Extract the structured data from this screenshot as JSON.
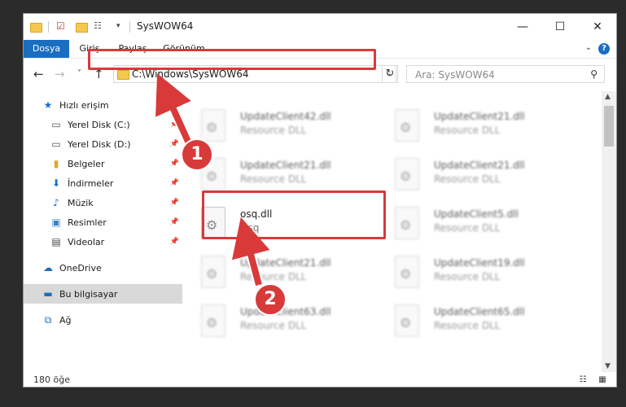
{
  "window": {
    "title": "SysWOW64"
  },
  "ribbon": {
    "tabs": [
      {
        "label": "Dosya",
        "active": true
      },
      {
        "label": "Giriş",
        "active": false
      },
      {
        "label": "Paylaş",
        "active": false
      },
      {
        "label": "Görünüm",
        "active": false
      }
    ],
    "help": "?"
  },
  "nav": {
    "back": "←",
    "forward": "→",
    "recent": "˅",
    "up": "↑",
    "address": "C:\\Windows\\SysWOW64",
    "address_dropdown": "⌄",
    "refresh": "↻",
    "search_placeholder": "Ara: SysWOW64",
    "search_icon": "⚲"
  },
  "sidebar": {
    "items": [
      {
        "label": "Hızlı erişim",
        "icon": "star-icon",
        "pinned": false
      },
      {
        "label": "Yerel Disk (C:)",
        "icon": "drive-icon",
        "pinned": true
      },
      {
        "label": "Yerel Disk (D:)",
        "icon": "drive-icon",
        "pinned": true
      },
      {
        "label": "Belgeler",
        "icon": "documents-icon",
        "pinned": true
      },
      {
        "label": "İndirmeler",
        "icon": "download-icon",
        "pinned": true
      },
      {
        "label": "Müzik",
        "icon": "music-icon",
        "pinned": true
      },
      {
        "label": "Resimler",
        "icon": "pictures-icon",
        "pinned": true
      },
      {
        "label": "Videolar",
        "icon": "videos-icon",
        "pinned": true
      },
      {
        "label": "OneDrive",
        "icon": "cloud-icon",
        "pinned": false
      },
      {
        "label": "Bu bilgisayar",
        "icon": "computer-icon",
        "pinned": false,
        "selected": true
      },
      {
        "label": "Ağ",
        "icon": "network-icon",
        "pinned": false
      }
    ]
  },
  "files": [
    {
      "name": "UpdateClient42.dll",
      "desc": "Resource DLL"
    },
    {
      "name": "UpdateClient21.dll",
      "desc": "Resource DLL"
    },
    {
      "name": "UpdateClient21.dll",
      "desc": "Resource DLL"
    },
    {
      "name": "UpdateClient21.dll",
      "desc": "Resource DLL"
    },
    {
      "name": "osq.dll",
      "desc": "Osq"
    },
    {
      "name": "UpdateClient5.dll",
      "desc": "Resource DLL"
    },
    {
      "name": "UpdateClient21.dll",
      "desc": "Resource DLL"
    },
    {
      "name": "UpdateClient19.dll",
      "desc": "Resource DLL"
    },
    {
      "name": "UpdateClient63.dll",
      "desc": "Resource DLL"
    },
    {
      "name": "UpdateClient65.dll",
      "desc": "Resource DLL"
    }
  ],
  "status": {
    "count": "180 öğe"
  },
  "callouts": {
    "one": "1",
    "two": "2"
  },
  "colors": {
    "accent": "#1a6ec0",
    "highlight": "#d83a3a",
    "selected": "#d9d9d9"
  }
}
